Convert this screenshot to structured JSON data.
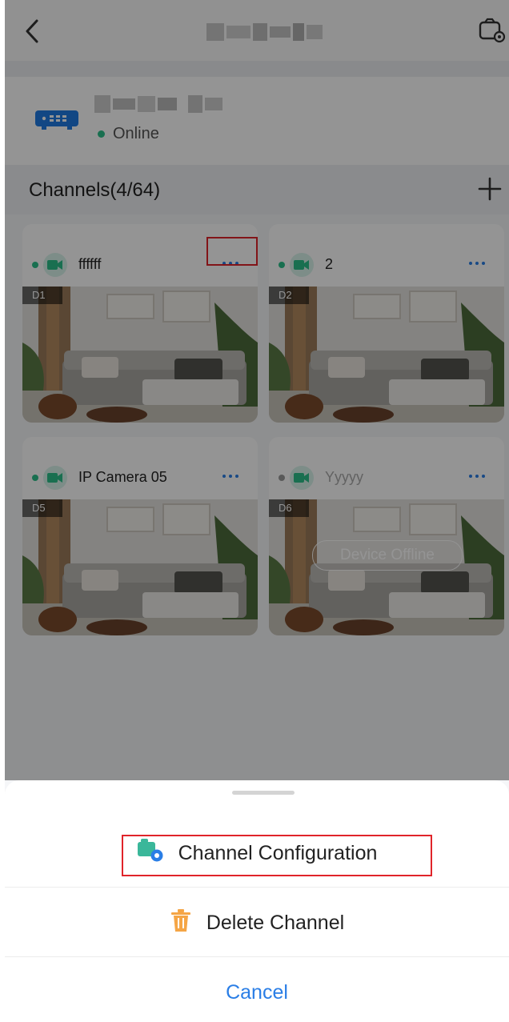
{
  "device": {
    "status": "Online"
  },
  "channels": {
    "label": "Channels(4/64)"
  },
  "cards": [
    {
      "name": "ffffff",
      "tag": "D1",
      "online": true
    },
    {
      "name": "2",
      "tag": "D2",
      "online": true
    },
    {
      "name": "IP Camera 05",
      "tag": "D5",
      "online": true
    },
    {
      "name": "Yyyyy",
      "tag": "D6",
      "online": false,
      "overlay": "Device Offline"
    }
  ],
  "sheet": {
    "channel_config": "Channel Configuration",
    "delete_channel": "Delete Channel",
    "cancel": "Cancel"
  },
  "colors": {
    "accent": "#2a7ee6",
    "online": "#2bc08a",
    "offline": "#9a9a9a",
    "highlight": "#e0242a",
    "delete_icon": "#f5a545"
  }
}
